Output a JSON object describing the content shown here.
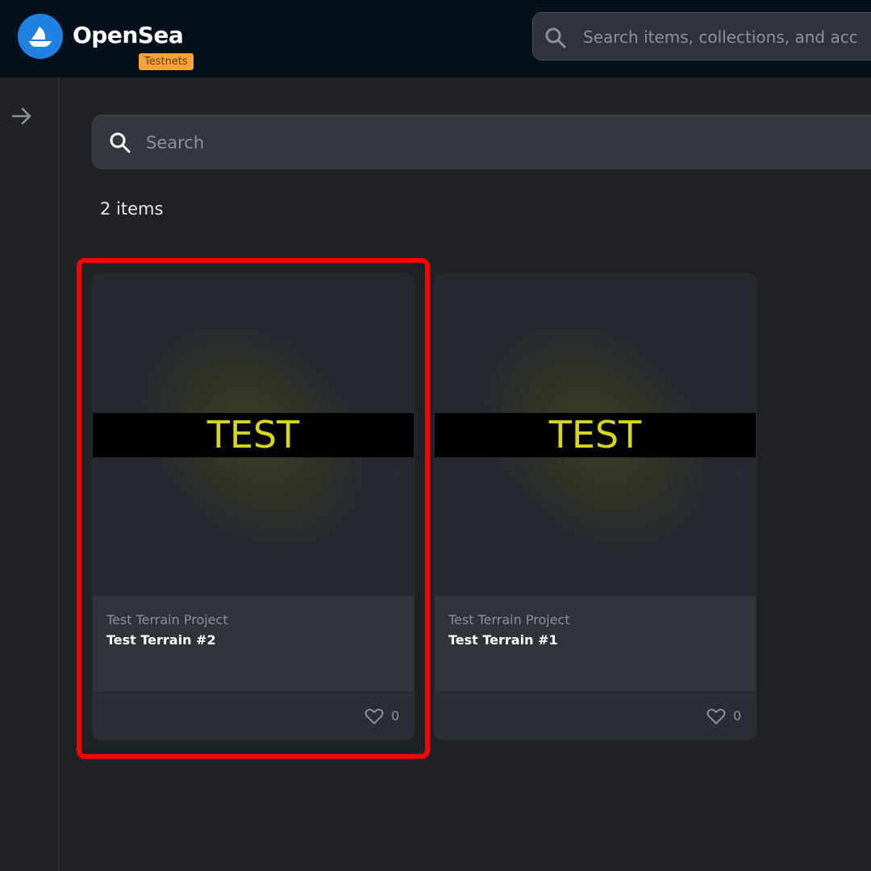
{
  "navbar": {
    "brand": "OpenSea",
    "badge": "Testnets",
    "search_placeholder": "Search items, collections, and acc"
  },
  "colors": {
    "nav_bg": "#04111d",
    "brand_blue": "#2081e2",
    "badge_orange": "#f6a23b",
    "highlight_red": "#ff0000",
    "test_text_yellow": "#d6d621"
  },
  "main": {
    "search_placeholder": "Search",
    "item_count": "2 items"
  },
  "cards": [
    {
      "image_text": "TEST",
      "collection": "Test Terrain Project",
      "name": "Test Terrain #2",
      "likes": "0",
      "highlighted": true
    },
    {
      "image_text": "TEST",
      "collection": "Test Terrain Project",
      "name": "Test Terrain #1",
      "likes": "0",
      "highlighted": false
    }
  ],
  "icons": {
    "logo": "opensea-boat-icon",
    "search": "search-icon",
    "sidebar_toggle": "arrow-right-icon",
    "like": "heart-icon"
  }
}
